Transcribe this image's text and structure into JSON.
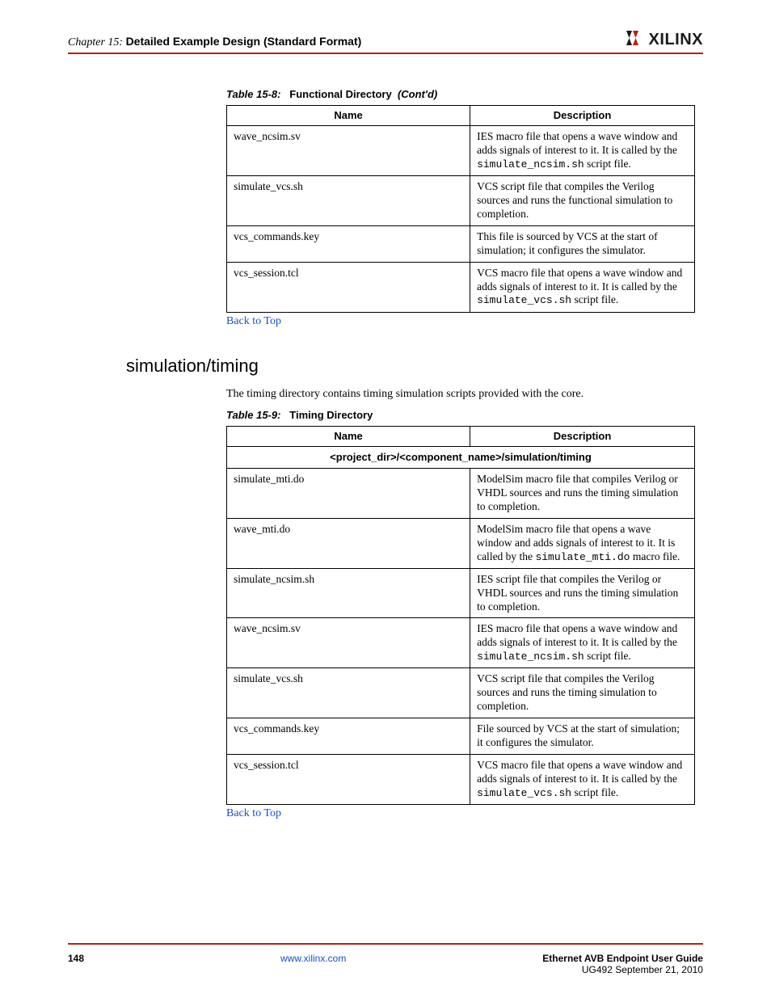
{
  "header": {
    "chapter_label": "Chapter 15:",
    "chapter_title": "Detailed Example Design (Standard Format)",
    "logo_text": "XILINX"
  },
  "table1": {
    "caption_prefix": "Table 15-8:",
    "caption_title": "Functional Directory",
    "caption_suffix": "(Cont'd)",
    "col1": "Name",
    "col2": "Description",
    "rows": [
      {
        "name": "wave_ncsim.sv",
        "desc_pre": "IES macro file that opens a wave window and adds signals of interest to it. It is called by the ",
        "desc_code": "simulate_ncsim.sh",
        "desc_post": " script file."
      },
      {
        "name": "simulate_vcs.sh",
        "desc_pre": "VCS script file that compiles the Verilog sources and runs the functional simulation to completion.",
        "desc_code": "",
        "desc_post": ""
      },
      {
        "name": "vcs_commands.key",
        "desc_pre": "This file is sourced by VCS at the start of simulation; it configures the simulator.",
        "desc_code": "",
        "desc_post": ""
      },
      {
        "name": "vcs_session.tcl",
        "desc_pre": "VCS macro file that opens a wave window and adds signals of interest to it. It is called by the ",
        "desc_code": "simulate_vcs.sh",
        "desc_post": " script file."
      }
    ],
    "back_link": "Back to Top"
  },
  "section": {
    "heading": "simulation/timing",
    "intro": "The timing directory contains timing simulation scripts provided with the core."
  },
  "table2": {
    "caption_prefix": "Table 15-9:",
    "caption_title": "Timing Directory",
    "col1": "Name",
    "col2": "Description",
    "section_header": "<project_dir>/<component_name>/simulation/timing",
    "rows": [
      {
        "name": "simulate_mti.do",
        "desc_pre": "ModelSim macro file that compiles Verilog or VHDL sources and runs the timing simulation to completion.",
        "desc_code": "",
        "desc_post": ""
      },
      {
        "name": "wave_mti.do",
        "desc_pre": "ModelSim macro file that opens a wave window and adds signals of interest to it. It is called by the ",
        "desc_code": "simulate_mti.do",
        "desc_post": " macro file."
      },
      {
        "name": "simulate_ncsim.sh",
        "desc_pre": "IES script file that compiles the Verilog or VHDL sources and runs the timing simulation to completion.",
        "desc_code": "",
        "desc_post": ""
      },
      {
        "name": "wave_ncsim.sv",
        "desc_pre": "IES macro file that opens a wave window and adds signals of interest to it. It is called by the ",
        "desc_code": "simulate_ncsim.sh",
        "desc_post": " script file."
      },
      {
        "name": "simulate_vcs.sh",
        "desc_pre": "VCS script file that compiles the Verilog sources and runs the timing simulation to completion.",
        "desc_code": "",
        "desc_post": ""
      },
      {
        "name": "vcs_commands.key",
        "desc_pre": "File sourced by VCS at the start of simulation; it configures the simulator.",
        "desc_code": "",
        "desc_post": ""
      },
      {
        "name": "vcs_session.tcl",
        "desc_pre": "VCS macro file that opens a wave window and adds signals of interest to it. It is called by the ",
        "desc_code": "simulate_vcs.sh",
        "desc_post": " script file."
      }
    ],
    "back_link": "Back to Top"
  },
  "footer": {
    "page": "148",
    "center": "www.xilinx.com",
    "right_title": "Ethernet AVB Endpoint User Guide",
    "right_sub": "UG492 September 21, 2010"
  }
}
